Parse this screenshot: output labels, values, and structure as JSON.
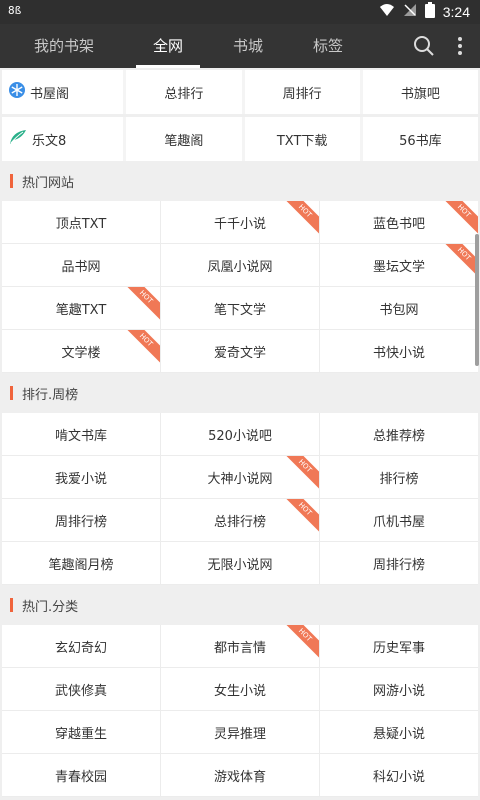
{
  "status_bar": {
    "left_text": "8ß",
    "time": "3:24"
  },
  "nav": {
    "tabs": [
      {
        "label": "我的书架",
        "active": false
      },
      {
        "label": "全网",
        "active": true
      },
      {
        "label": "书城",
        "active": false
      },
      {
        "label": "标签",
        "active": false
      }
    ],
    "icons": [
      "search-icon",
      "more-vertical-icon"
    ]
  },
  "sources": [
    {
      "brand": "书屋阁",
      "brand_icon": "snowflake-icon",
      "links": [
        "总排行",
        "周排行",
        "书旗吧"
      ]
    },
    {
      "brand": "乐文8",
      "brand_icon": "leaf-icon",
      "links": [
        "笔趣阁",
        "TXT下载",
        "56书库"
      ]
    }
  ],
  "hot_badge": "HOT",
  "sections": [
    {
      "title": "热门网站",
      "rows": [
        [
          {
            "label": "顶点TXT",
            "hot": false
          },
          {
            "label": "千千小说",
            "hot": true
          },
          {
            "label": "蓝色书吧",
            "hot": true
          }
        ],
        [
          {
            "label": "品书网",
            "hot": false
          },
          {
            "label": "凤凰小说网",
            "hot": false
          },
          {
            "label": "墨坛文学",
            "hot": true
          }
        ],
        [
          {
            "label": "笔趣TXT",
            "hot": true
          },
          {
            "label": "笔下文学",
            "hot": false
          },
          {
            "label": "书包网",
            "hot": false
          }
        ],
        [
          {
            "label": "文学楼",
            "hot": true
          },
          {
            "label": "爱奇文学",
            "hot": false
          },
          {
            "label": "书快小说",
            "hot": false
          }
        ]
      ]
    },
    {
      "title": "排行.周榜",
      "rows": [
        [
          {
            "label": "啃文书库",
            "hot": false
          },
          {
            "label": "520小说吧",
            "hot": false
          },
          {
            "label": "总推荐榜",
            "hot": false
          }
        ],
        [
          {
            "label": "我爱小说",
            "hot": false
          },
          {
            "label": "大神小说网",
            "hot": true
          },
          {
            "label": "排行榜",
            "hot": false
          }
        ],
        [
          {
            "label": "周排行榜",
            "hot": false
          },
          {
            "label": "总排行榜",
            "hot": true
          },
          {
            "label": "爪机书屋",
            "hot": false
          }
        ],
        [
          {
            "label": "笔趣阁月榜",
            "hot": false
          },
          {
            "label": "无限小说网",
            "hot": false
          },
          {
            "label": "周排行榜",
            "hot": false
          }
        ]
      ]
    },
    {
      "title": "热门.分类",
      "rows": [
        [
          {
            "label": "玄幻奇幻",
            "hot": false
          },
          {
            "label": "都市言情",
            "hot": true
          },
          {
            "label": "历史军事",
            "hot": false
          }
        ],
        [
          {
            "label": "武侠修真",
            "hot": false
          },
          {
            "label": "女生小说",
            "hot": false
          },
          {
            "label": "网游小说",
            "hot": false
          }
        ],
        [
          {
            "label": "穿越重生",
            "hot": false
          },
          {
            "label": "灵异推理",
            "hot": false
          },
          {
            "label": "悬疑小说",
            "hot": false
          }
        ],
        [
          {
            "label": "青春校园",
            "hot": false
          },
          {
            "label": "游戏体育",
            "hot": false
          },
          {
            "label": "科幻小说",
            "hot": false
          }
        ]
      ]
    }
  ],
  "colors": {
    "accent": "#f0643c",
    "hot_badge": "#f07856",
    "navbar": "#343434",
    "statusbar": "#2f2f2f"
  }
}
